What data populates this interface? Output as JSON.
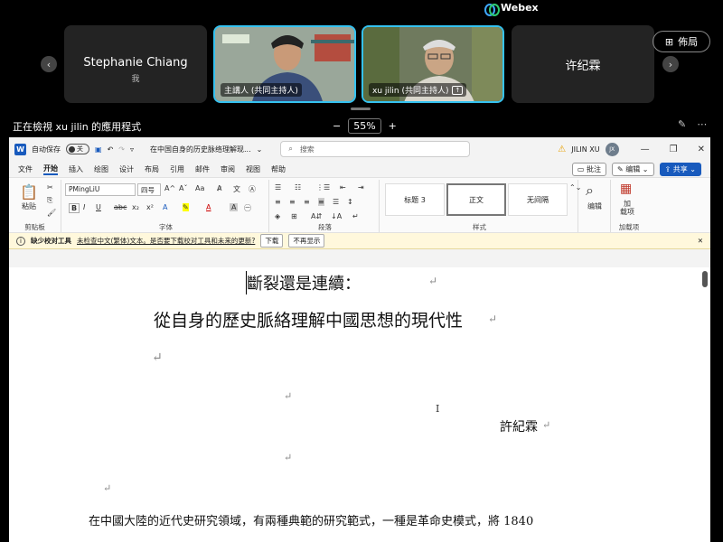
{
  "app": {
    "name": "Webex",
    "accent": "#35c2f0"
  },
  "participants": [
    {
      "name": "Stephanie Chiang",
      "sub": "我"
    },
    {
      "label": "主講人 (共同主持人)"
    },
    {
      "label": "xu jilin (共同主持人)"
    },
    {
      "name": "许纪霖"
    }
  ],
  "layout_button": "佈局",
  "viewing_text": "正在檢視 xu jilin 的應用程式",
  "zoom": {
    "minus": "−",
    "value": "55%",
    "plus": "+"
  },
  "word": {
    "autosave": "自动保存",
    "autosave_state": "关",
    "doc_title": "在中国自身的历史脉络理解现...",
    "search_placeholder": "搜索",
    "user": "JILIN XU",
    "initials": "JX",
    "tabs": [
      "文件",
      "开始",
      "插入",
      "绘图",
      "设计",
      "布局",
      "引用",
      "邮件",
      "审阅",
      "视图",
      "帮助"
    ],
    "comment_btn": "批注",
    "edit_btn": "编辑",
    "share_btn": "共享",
    "ribbon": {
      "paste": "粘贴",
      "clipboard": "剪贴板",
      "font_name": "PMingLiU",
      "font_size": "四号",
      "font_group": "字体",
      "para_group": "段落",
      "styles": [
        "标题 3",
        "正文",
        "无间隔"
      ],
      "styles_group": "样式",
      "editing": "编辑",
      "addins": "加\n载项",
      "addins_group": "加载项"
    },
    "infobar": {
      "title": "缺少校对工具",
      "message": "未检查中文(繁体)文本。是否要下载校对工具和未来的更新?",
      "download": "下载",
      "dont_show": "不再显示"
    }
  },
  "document": {
    "title_line1": "斷裂還是連續：",
    "title_line2": "從自身的歷史脈絡理解中國思想的現代性",
    "author": "許紀霖",
    "body_line": "在中國大陸的近代史研究領域，有兩種典範的研究範式，一種是革命史模式，將 1840",
    "return_mark": "↵"
  }
}
